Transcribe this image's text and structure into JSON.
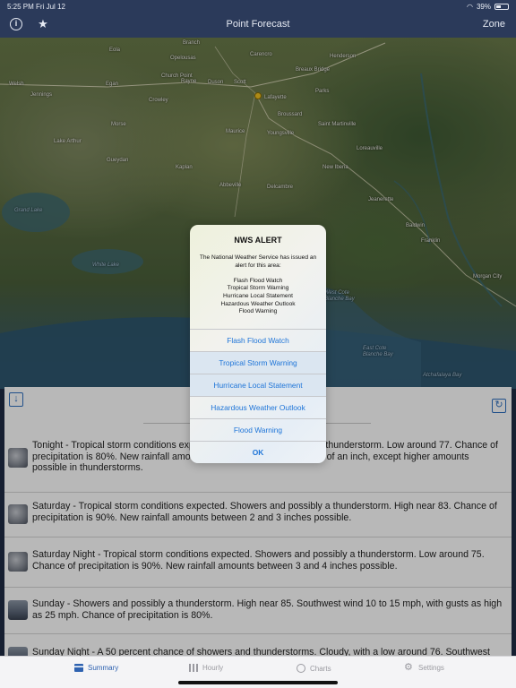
{
  "status_bar": {
    "time": "5:25 PM  Fri Jul 12",
    "battery": "39%"
  },
  "nav": {
    "title": "Point Forecast",
    "zone_label": "Zone"
  },
  "map": {
    "labels": [
      "Branch",
      "Carencro",
      "Henderson",
      "Opelousas",
      "Eola",
      "Church Point",
      "Breaux Bridge",
      "Welsh",
      "Egan",
      "Rayne",
      "Duson",
      "Scott",
      "Jennings",
      "Crowley",
      "Lafayette",
      "Parks",
      "Broussard",
      "Morse",
      "Saint Martinville",
      "Maurice",
      "Youngsville",
      "Lake Arthur",
      "Loreauville",
      "Gueydan",
      "Kaplan",
      "New Iberia",
      "Abbeville",
      "Delcambre",
      "Jeanerette",
      "Grand Lake",
      "Baldwin",
      "Franklin",
      "White Lake",
      "West Cote Blanche Bay",
      "Morgan City",
      "East Cote Blanche Bay",
      "Atchafalaya Bay"
    ]
  },
  "alert": {
    "title": "NWS ALERT",
    "message": "The National Weather Service has issued an alert for this area:\n\nFlash Flood Watch\nTropical Storm Warning\nHurricane Local Statement\nHazardous Weather Outlook\nFlood Warning",
    "buttons": [
      "Flash Flood Watch",
      "Tropical Storm Warning",
      "Hurricane Local Statement",
      "Hazardous Weather Outlook",
      "Flood Warning"
    ],
    "ok_label": "OK"
  },
  "forecast": [
    {
      "icon": "storm-icon",
      "text": "Tonight - Tropical storm conditions expected. Showers and possibly a thunderstorm.  Low around 77. Chance of precipitation is 80%. New rainfall amounts between a quarter and half of an inch, except higher amounts possible in thunderstorms."
    },
    {
      "icon": "storm-icon",
      "text": "Saturday - Tropical storm conditions expected. Showers and possibly a thunderstorm.  High near 83. Chance of precipitation is 90%. New rainfall amounts between 2 and 3 inches possible."
    },
    {
      "icon": "storm-icon",
      "text": "Saturday Night - Tropical storm conditions expected. Showers and possibly a thunderstorm.  Low around 75. Chance of precipitation is 90%. New rainfall amounts between 3 and 4 inches possible."
    },
    {
      "icon": "showers-icon",
      "text": "Sunday - Showers and possibly a thunderstorm.  High near 85. Southwest wind 10 to 15 mph, with gusts as high as 25 mph.  Chance of precipitation is 80%."
    },
    {
      "icon": "showers-icon",
      "text": "Sunday Night - A 50 percent chance of showers and thunderstorms.  Cloudy, with a low around 76. Southwest"
    }
  ],
  "tabs": [
    {
      "label": "Summary",
      "icon": "summary-icon",
      "active": true
    },
    {
      "label": "Hourly",
      "icon": "hourly-icon",
      "active": false
    },
    {
      "label": "Charts",
      "icon": "charts-icon",
      "active": false
    },
    {
      "label": "Settings",
      "icon": "gear-icon",
      "active": false
    }
  ]
}
